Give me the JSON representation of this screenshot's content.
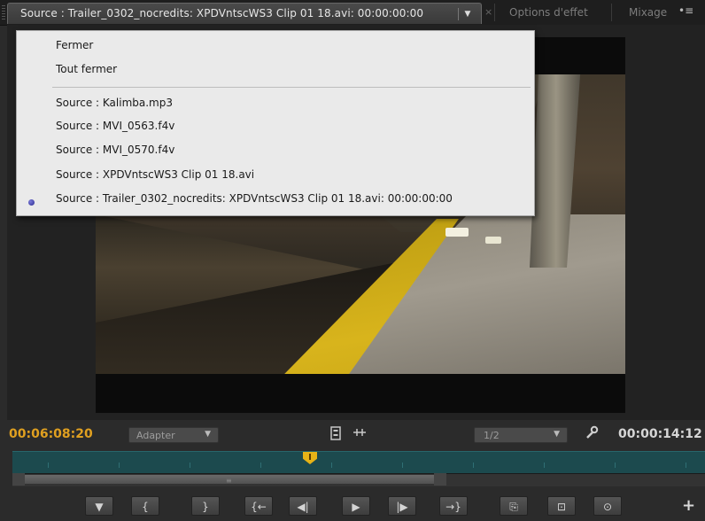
{
  "tabs": {
    "source_tab_label": "Source : Trailer_0302_nocredits: XPDVntscWS3 Clip 01 18.avi: 00:00:00:00",
    "dropdown_arrow": "▼",
    "close": "×",
    "effect_options": "Options d'effet",
    "mixage": "Mixage",
    "panel_menu": "•≡"
  },
  "menu": {
    "close": "Fermer",
    "close_all": "Tout fermer",
    "sources": [
      "Source : Kalimba.mp3",
      "Source : MVI_0563.f4v",
      "Source : MVI_0570.f4v",
      "Source : XPDVntscWS3 Clip 01 18.avi",
      "Source : Trailer_0302_nocredits: XPDVntscWS3 Clip 01 18.avi: 00:00:00:00"
    ],
    "selected_index": 4
  },
  "controls": {
    "timecode_current": "00:06:08:20",
    "zoom_select": "Adapter",
    "resolution_select": "1/2",
    "timecode_duration": "00:00:14:12",
    "dropdown_arrow": "▼"
  },
  "transport": {
    "marker": "▼",
    "mark_in": "{",
    "mark_out": "}",
    "go_to_in": "{←",
    "step_back": "◀|",
    "play": "▶",
    "step_forward": "|▶",
    "go_to_out": "→}",
    "insert": "⎘",
    "overwrite": "⊡",
    "export_frame": "⊙",
    "add_button": "+"
  },
  "colors": {
    "timecode_accent": "#e0a020",
    "timeline": "#1c4a4e",
    "playhead": "#e6b317"
  }
}
